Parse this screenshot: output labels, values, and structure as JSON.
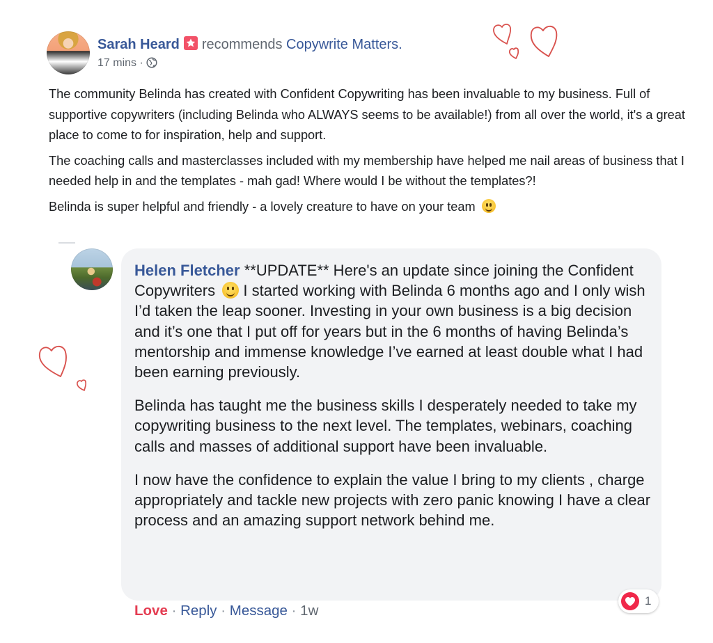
{
  "post": {
    "author": "Sarah Heard",
    "recommends_text": "recommends",
    "page_name": "Copywrite Matters.",
    "time": "17 mins",
    "dot": "·",
    "paragraphs": [
      "The community Belinda has created with Confident Copywriting has been invaluable to my business. Full of supportive copywriters (including Belinda who ALWAYS seems to be available!) from all over the world, it's a great place to come to for inspiration, help and support.",
      "The coaching calls and masterclasses included with my membership have helped me nail areas of business that I needed help in and the templates - mah gad! Where would I be without the templates?!",
      "Belinda is super helpful and friendly - a lovely creature to have on your team"
    ]
  },
  "comment": {
    "author": "Helen Fletcher",
    "intro": " **UPDATE** Here's an update since joining the Confident Copywriters",
    "p1_rest": " I started working with Belinda 6 months ago and I only wish I’d taken the leap sooner. Investing in your own business is a big decision and it’s one that I put off for years but in the 6 months of having Belinda’s mentorship and immense knowledge I’ve earned at least double what I had been earning previously.",
    "p2": "Belinda has taught me the business skills I desperately needed to take my copywriting business to the next level. The templates, webinars, coaching calls and masses of additional support have been invaluable.",
    "p3": "I now have the confidence to explain the value I bring to my clients , charge appropriately and tackle new projects with zero panic knowing I have a clear process and an amazing support network behind me."
  },
  "actions": {
    "love": "Love",
    "reply": "Reply",
    "message": "Message",
    "time": "1w",
    "dot": "·"
  },
  "reactions": {
    "count": "1"
  },
  "colors": {
    "link_blue": "#385898",
    "love_red": "#e43d52",
    "doodle_red": "#d9534f",
    "bubble_bg": "#f2f3f5"
  }
}
